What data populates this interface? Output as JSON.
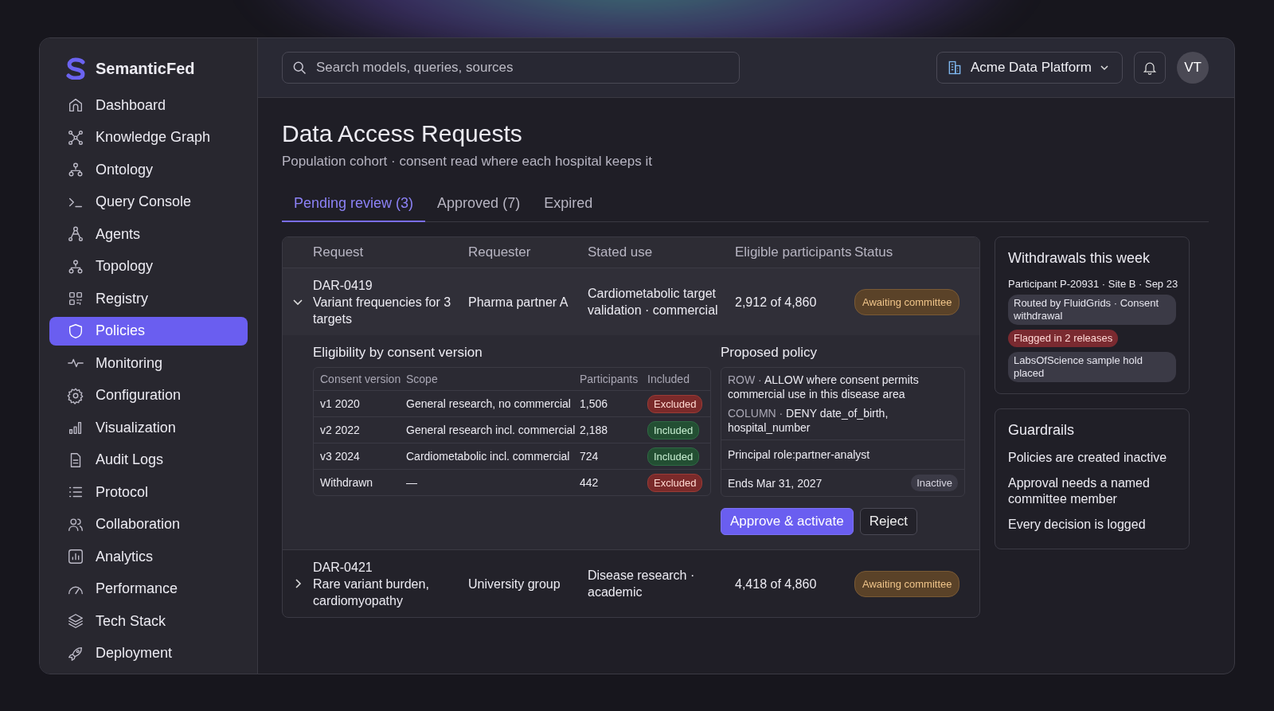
{
  "brand": {
    "name": "SemanticFed"
  },
  "nav": [
    {
      "label": "Dashboard",
      "kind": "home",
      "selected": false
    },
    {
      "label": "Knowledge Graph",
      "kind": "graph",
      "selected": false
    },
    {
      "label": "Ontology",
      "kind": "tree",
      "selected": false
    },
    {
      "label": "Query Console",
      "kind": "terminal",
      "selected": false
    },
    {
      "label": "Agents",
      "kind": "agents",
      "selected": false
    },
    {
      "label": "Topology",
      "kind": "tree",
      "selected": false
    },
    {
      "label": "Registry",
      "kind": "grid",
      "selected": false
    },
    {
      "label": "Policies",
      "kind": "shield",
      "selected": true
    },
    {
      "label": "Monitoring",
      "kind": "pulse",
      "selected": false
    },
    {
      "label": "Configuration",
      "kind": "gear",
      "selected": false
    },
    {
      "label": "Visualization",
      "kind": "bars",
      "selected": false
    },
    {
      "label": "Audit Logs",
      "kind": "doc",
      "selected": false
    },
    {
      "label": "Protocol",
      "kind": "list",
      "selected": false
    },
    {
      "label": "Collaboration",
      "kind": "users",
      "selected": false
    },
    {
      "label": "Analytics",
      "kind": "chart",
      "selected": false
    },
    {
      "label": "Performance",
      "kind": "gauge",
      "selected": false
    },
    {
      "label": "Tech Stack",
      "kind": "layers",
      "selected": false
    },
    {
      "label": "Deployment",
      "kind": "rocket",
      "selected": false
    }
  ],
  "topbar": {
    "search": {
      "placeholder": "Search models, queries, sources"
    },
    "workspace": "Acme Data Platform",
    "avatar": "VT"
  },
  "page": {
    "title": "Data Access Requests",
    "subtitle": "Population cohort · consent read where each hospital keeps it"
  },
  "tabs": [
    {
      "label": "Pending review (3)",
      "selected": true
    },
    {
      "label": "Approved (7)",
      "selected": false
    },
    {
      "label": "Expired",
      "selected": false
    }
  ],
  "requests": {
    "columns": [
      "Request",
      "Requester",
      "Stated use",
      "Eligible participants",
      "Status"
    ],
    "rows": [
      {
        "id": "DAR-0419",
        "title": "Variant frequencies for 3 targets",
        "requester": "Pharma partner A",
        "use": "Cardiometabolic target validation · commercial",
        "eligible": "2,912 of 4,860",
        "status": "Awaiting committee",
        "expanded": true,
        "detail": {
          "eligibility_title": "Eligibility by consent version",
          "columns": [
            "Consent version",
            "Scope",
            "Participants",
            "Included"
          ],
          "versions": [
            {
              "version": "v1 2020",
              "scope": "General research, no commercial",
              "participants": "1,506",
              "included": false,
              "badge": "Excluded"
            },
            {
              "version": "v2 2022",
              "scope": "General research incl. commercial",
              "participants": "2,188",
              "included": true,
              "badge": "Included"
            },
            {
              "version": "v3 2024",
              "scope": "Cardiometabolic incl. commercial",
              "participants": "724",
              "included": true,
              "badge": "Included"
            },
            {
              "version": "Withdrawn",
              "scope": "—",
              "participants": "442",
              "included": false,
              "badge": "Excluded"
            }
          ],
          "policy_title": "Proposed policy",
          "rules": [
            {
              "type": "ROW ·",
              "text": "ALLOW where consent permits commercial use in this disease area"
            },
            {
              "type": "COLUMN ·",
              "text": "DENY date_of_birth, hospital_number"
            }
          ],
          "principal": "Principal role:partner-analyst",
          "ends": "Ends Mar 31, 2027",
          "policy_state": "Inactive",
          "actions": [
            {
              "label": "Approve & activate",
              "kind": "primary"
            },
            {
              "label": "Reject",
              "kind": "secondary"
            }
          ]
        }
      },
      {
        "id": "DAR-0421",
        "title": "Rare variant burden, cardiomyopathy",
        "requester": "University group",
        "use": "Disease research · academic",
        "eligible": "4,418 of 4,860",
        "status": "Awaiting committee",
        "expanded": false
      }
    ]
  },
  "withdrawals": {
    "title": "Withdrawals this week",
    "entry": "Participant P-20931 · Site B · Sep 23",
    "tags": [
      {
        "text": "Routed by FluidGrids · Consent withdrawal",
        "kind": "neutral"
      },
      {
        "text": "Flagged in 2 releases",
        "kind": "flag"
      },
      {
        "text": "LabsOfScience sample hold placed",
        "kind": "neutral"
      }
    ]
  },
  "guardrails": {
    "title": "Guardrails",
    "items": [
      "Policies are created inactive",
      "Approval needs a named committee member",
      "Every decision is logged"
    ]
  }
}
